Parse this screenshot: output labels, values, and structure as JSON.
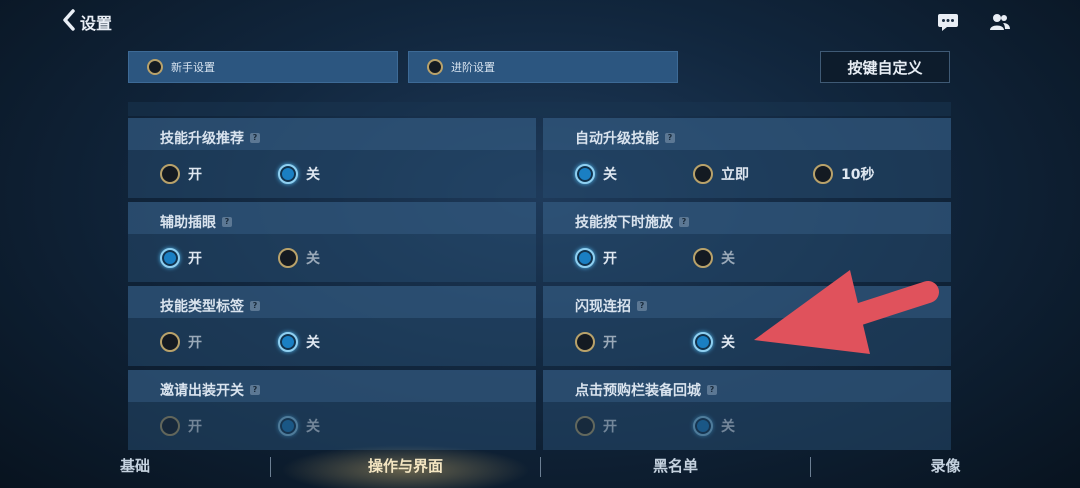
{
  "header": {
    "title": "设置",
    "icons": [
      "chevron-left-icon",
      "chat-icon",
      "friends-icon"
    ]
  },
  "mode_tabs": [
    {
      "label": "新手设置",
      "selected": false
    },
    {
      "label": "进阶设置",
      "selected": false
    }
  ],
  "custom_keys_label": "按键自定义",
  "settings": [
    {
      "title": "技能升级推荐",
      "help": "?",
      "options": [
        {
          "label": "开",
          "selected": false
        },
        {
          "label": "关",
          "selected": true
        }
      ]
    },
    {
      "title": "自动升级技能",
      "help": "?",
      "options": [
        {
          "label": "关",
          "selected": true
        },
        {
          "label": "立即",
          "selected": false
        },
        {
          "label": "10秒",
          "selected": false
        }
      ]
    },
    {
      "title": "辅助插眼",
      "help": "?",
      "options": [
        {
          "label": "开",
          "selected": true
        },
        {
          "label": "关",
          "selected": false
        }
      ]
    },
    {
      "title": "技能按下时施放",
      "help": "?",
      "options": [
        {
          "label": "开",
          "selected": true
        },
        {
          "label": "关",
          "selected": false
        }
      ]
    },
    {
      "title": "技能类型标签",
      "help": "?",
      "options": [
        {
          "label": "开",
          "selected": false
        },
        {
          "label": "关",
          "selected": true
        }
      ]
    },
    {
      "title": "闪现连招",
      "help": "?",
      "options": [
        {
          "label": "开",
          "selected": false
        },
        {
          "label": "关",
          "selected": true
        }
      ]
    },
    {
      "title": "邀请出装开关",
      "help": "?",
      "options": [
        {
          "label": "开",
          "selected": false
        },
        {
          "label": "关",
          "selected": true
        }
      ]
    },
    {
      "title": "点击预购栏装备回城",
      "help": "?",
      "options": [
        {
          "label": "开",
          "selected": false
        },
        {
          "label": "关",
          "selected": true
        }
      ]
    }
  ],
  "bottom_nav": [
    {
      "label": "基础",
      "active": false
    },
    {
      "label": "操作与界面",
      "active": true
    },
    {
      "label": "黑名单",
      "active": false
    },
    {
      "label": "录像",
      "active": false
    }
  ],
  "colors": {
    "accent_blue": "#1a7fc3",
    "panel": "#264a6e",
    "active_tab_glow": "#d2b46e",
    "annotation_arrow": "#e0525c"
  }
}
